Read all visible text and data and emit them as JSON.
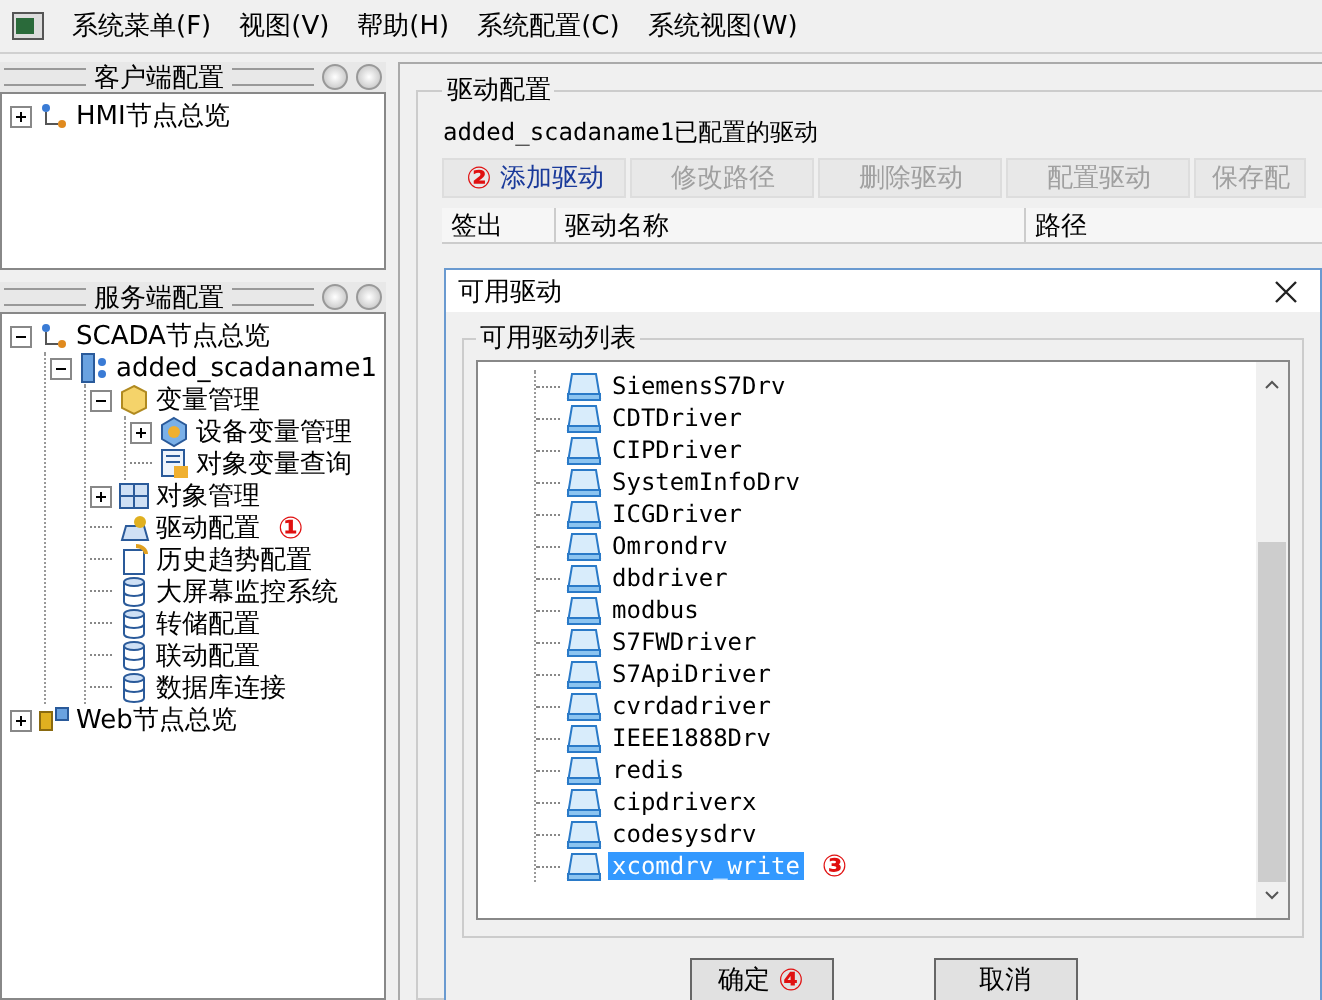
{
  "menu_bar": {
    "items": [
      "系统菜单(F)",
      "视图(V)",
      "帮助(H)",
      "系统配置(C)",
      "系统视图(W)"
    ]
  },
  "client_panel": {
    "title": "客户端配置",
    "tree": [
      {
        "label": "HMI节点总览",
        "kind": "network",
        "expanded": false
      }
    ]
  },
  "server_panel": {
    "title": "服务端配置",
    "tree": [
      {
        "label": "SCADA节点总览",
        "kind": "network",
        "expanded": true,
        "children": [
          {
            "label": "added_scadaname1",
            "kind": "server",
            "expanded": true,
            "children": [
              {
                "label": "变量管理",
                "kind": "cube",
                "expanded": true,
                "children": [
                  {
                    "label": "设备变量管理",
                    "kind": "device",
                    "expanded": false
                  },
                  {
                    "label": "对象变量查询",
                    "kind": "query"
                  }
                ]
              },
              {
                "label": "对象管理",
                "kind": "grid",
                "expanded": false
              },
              {
                "label": "驱动配置",
                "kind": "drive",
                "marker": "①"
              },
              {
                "label": "历史趋势配置",
                "kind": "history"
              },
              {
                "label": "大屏幕监控系统",
                "kind": "database"
              },
              {
                "label": "转储配置",
                "kind": "database"
              },
              {
                "label": "联动配置",
                "kind": "database"
              },
              {
                "label": "数据库连接",
                "kind": "database"
              }
            ]
          }
        ]
      },
      {
        "label": "Web节点总览",
        "kind": "web",
        "expanded": false
      }
    ]
  },
  "driver_config": {
    "title": "驱动配置",
    "subtitle": "added_scadaname1已配置的驱动",
    "buttons": [
      {
        "label": "添加驱动",
        "disabled": false,
        "marker": "②"
      },
      {
        "label": "修改路径",
        "disabled": true
      },
      {
        "label": "删除驱动",
        "disabled": true
      },
      {
        "label": "配置驱动",
        "disabled": true
      },
      {
        "label": "保存配",
        "disabled": true
      }
    ],
    "table": {
      "columns": [
        "签出",
        "驱动名称",
        "路径"
      ]
    }
  },
  "dialog": {
    "title": "可用驱动",
    "group_title": "可用驱动列表",
    "drivers": [
      {
        "name": "SiemensS7Drv",
        "selected": false
      },
      {
        "name": "CDTDriver",
        "selected": false
      },
      {
        "name": "CIPDriver",
        "selected": false
      },
      {
        "name": "SystemInfoDrv",
        "selected": false
      },
      {
        "name": "ICGDriver",
        "selected": false
      },
      {
        "name": "Omrondrv",
        "selected": false
      },
      {
        "name": "dbdriver",
        "selected": false
      },
      {
        "name": "modbus",
        "selected": false
      },
      {
        "name": "S7FWDriver",
        "selected": false
      },
      {
        "name": "S7ApiDriver",
        "selected": false
      },
      {
        "name": "cvrdadriver",
        "selected": false
      },
      {
        "name": "IEEE1888Drv",
        "selected": false
      },
      {
        "name": "redis",
        "selected": false
      },
      {
        "name": "cipdriverx",
        "selected": false
      },
      {
        "name": "codesysdrv",
        "selected": false
      },
      {
        "name": "xcomdrv_write",
        "selected": true,
        "marker": "③"
      }
    ],
    "buttons": [
      {
        "label": "确定",
        "marker": "④"
      },
      {
        "label": "取消"
      }
    ]
  }
}
